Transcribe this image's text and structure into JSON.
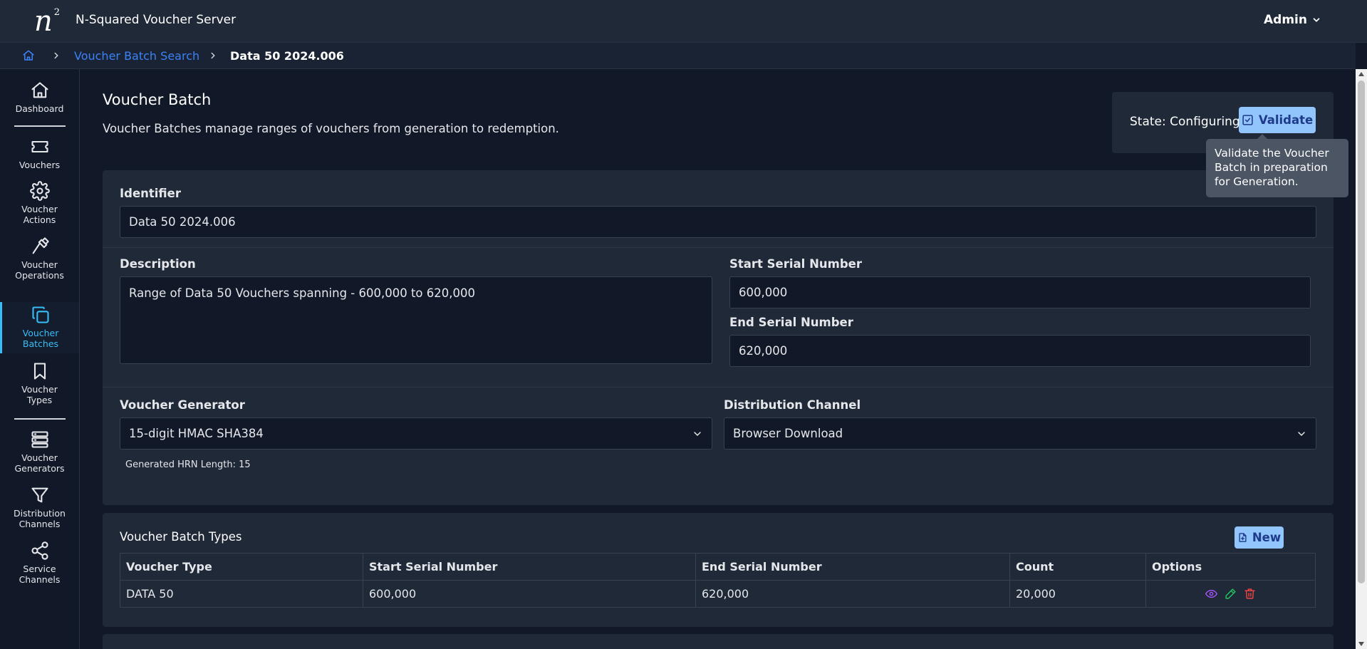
{
  "header": {
    "logo_letter": "n",
    "logo_superscript": "2",
    "app_title": "N-Squared Voucher Server",
    "user_menu": "Admin"
  },
  "breadcrumb": {
    "link": "Voucher Batch Search",
    "current": "Data 50 2024.006"
  },
  "sidebar": {
    "items": [
      {
        "label": "Dashboard",
        "icon": "home-icon"
      },
      {
        "label": "Vouchers",
        "icon": "ticket-icon"
      },
      {
        "label": "Voucher Actions",
        "icon": "gear-icon"
      },
      {
        "label": "Voucher Operations",
        "icon": "hammer-icon"
      },
      {
        "label": "Voucher Batches",
        "icon": "copy-icon",
        "active": true
      },
      {
        "label": "Voucher Types",
        "icon": "bookmark-icon"
      },
      {
        "label": "Voucher Generators",
        "icon": "server-icon"
      },
      {
        "label": "Distribution Channels",
        "icon": "filter-icon"
      },
      {
        "label": "Service Channels",
        "icon": "share-icon"
      }
    ]
  },
  "page": {
    "title": "Voucher Batch",
    "subtitle": "Voucher Batches manage ranges of vouchers from generation to redemption."
  },
  "state": {
    "label": "State: Configuring",
    "validate_label": "Validate",
    "tooltip": "Validate the Voucher Batch in preparation for Generation."
  },
  "form": {
    "identifier_label": "Identifier",
    "identifier_value": "Data 50 2024.006",
    "description_label": "Description",
    "description_value": "Range of Data 50 Vouchers spanning - 600,000 to 620,000",
    "start_serial_label": "Start Serial Number",
    "start_serial_value": "600,000",
    "end_serial_label": "End Serial Number",
    "end_serial_value": "620,000",
    "generator_label": "Voucher Generator",
    "generator_value": "15-digit HMAC SHA384",
    "generator_hint": "Generated HRN Length: 15",
    "channel_label": "Distribution Channel",
    "channel_value": "Browser Download"
  },
  "batch_types": {
    "title": "Voucher Batch Types",
    "new_label": "New",
    "columns": [
      "Voucher Type",
      "Start Serial Number",
      "End Serial Number",
      "Count",
      "Options"
    ],
    "rows": [
      {
        "type": "DATA 50",
        "start": "600,000",
        "end": "620,000",
        "count": "20,000"
      }
    ]
  },
  "colors": {
    "accent": "#38bdf8",
    "link": "#3b82f6",
    "button": "#93c5fd",
    "view_icon": "#a855f7",
    "edit_icon": "#22c55e",
    "delete_icon": "#ef4444"
  }
}
